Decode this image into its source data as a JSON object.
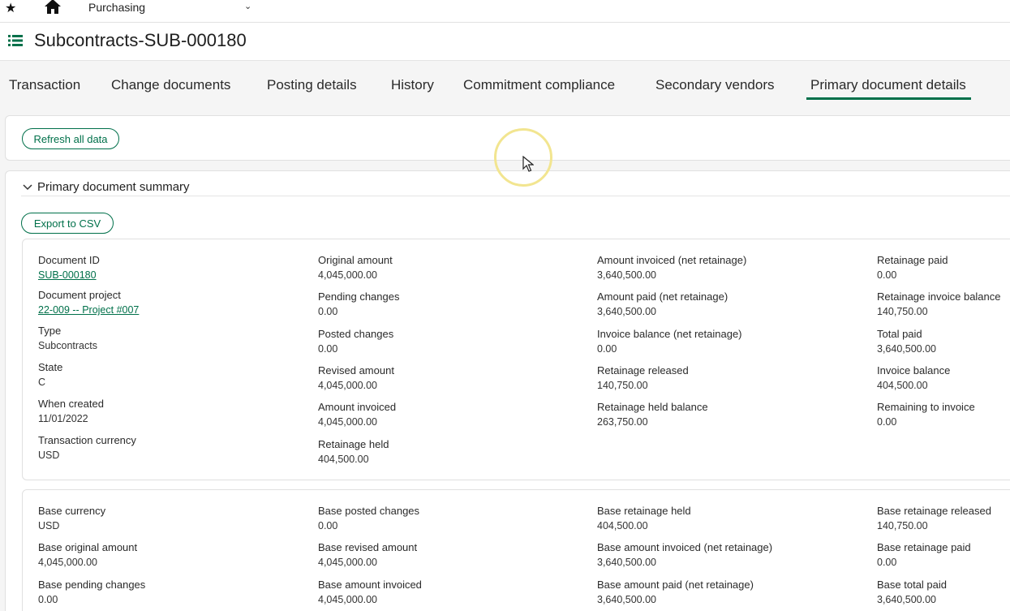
{
  "topbar": {
    "module": "Purchasing",
    "icons": [
      "star-icon",
      "home-icon",
      "chevron-down-icon"
    ]
  },
  "page": {
    "title": "Subcontracts-SUB-000180"
  },
  "tabs": [
    "Transaction",
    "Change documents",
    "Posting details",
    "History",
    "Commitment compliance",
    "Secondary vendors",
    "Primary document details"
  ],
  "active_tab": "Primary document details",
  "actions": {
    "refresh": "Refresh all data",
    "export": "Export to CSV"
  },
  "section": {
    "title": "Primary document summary"
  },
  "summary": {
    "col1": [
      {
        "label": "Document ID",
        "value": "SUB-000180",
        "link": true
      },
      {
        "label": "Document project",
        "value": "22-009 -- Project #007",
        "link": true
      },
      {
        "label": "Type",
        "value": "Subcontracts"
      },
      {
        "label": "State",
        "value": "C"
      },
      {
        "label": "When created",
        "value": "11/01/2022"
      },
      {
        "label": "Transaction currency",
        "value": "USD"
      }
    ],
    "col2": [
      {
        "label": "Original amount",
        "value": "4,045,000.00"
      },
      {
        "label": "Pending changes",
        "value": "0.00"
      },
      {
        "label": "Posted changes",
        "value": "0.00"
      },
      {
        "label": "Revised amount",
        "value": "4,045,000.00"
      },
      {
        "label": "Amount invoiced",
        "value": "4,045,000.00"
      },
      {
        "label": "Retainage held",
        "value": "404,500.00"
      }
    ],
    "col3": [
      {
        "label": "Amount invoiced (net retainage)",
        "value": "3,640,500.00"
      },
      {
        "label": "Amount paid (net retainage)",
        "value": "3,640,500.00"
      },
      {
        "label": "Invoice balance (net retainage)",
        "value": "0.00"
      },
      {
        "label": "Retainage released",
        "value": "140,750.00"
      },
      {
        "label": "Retainage held balance",
        "value": "263,750.00"
      }
    ],
    "col4": [
      {
        "label": "Retainage paid",
        "value": "0.00"
      },
      {
        "label": "Retainage invoice balance",
        "value": "140,750.00"
      },
      {
        "label": "Total paid",
        "value": "3,640,500.00"
      },
      {
        "label": "Invoice balance",
        "value": "404,500.00"
      },
      {
        "label": "Remaining to invoice",
        "value": "0.00"
      }
    ]
  },
  "base": {
    "col1": [
      {
        "label": "Base currency",
        "value": "USD"
      },
      {
        "label": "Base original amount",
        "value": "4,045,000.00"
      },
      {
        "label": "Base pending changes",
        "value": "0.00"
      }
    ],
    "col2": [
      {
        "label": "Base posted changes",
        "value": "0.00"
      },
      {
        "label": "Base revised amount",
        "value": "4,045,000.00"
      },
      {
        "label": "Base amount invoiced",
        "value": "4,045,000.00"
      }
    ],
    "col3": [
      {
        "label": "Base retainage held",
        "value": "404,500.00"
      },
      {
        "label": "Base amount invoiced (net retainage)",
        "value": "3,640,500.00"
      },
      {
        "label": "Base amount paid (net retainage)",
        "value": "3,640,500.00"
      }
    ],
    "col4": [
      {
        "label": "Base retainage released",
        "value": "140,750.00"
      },
      {
        "label": "Base retainage paid",
        "value": "0.00"
      },
      {
        "label": "Base total paid",
        "value": "3,640,500.00"
      }
    ]
  },
  "colors": {
    "accent": "#00704a"
  }
}
